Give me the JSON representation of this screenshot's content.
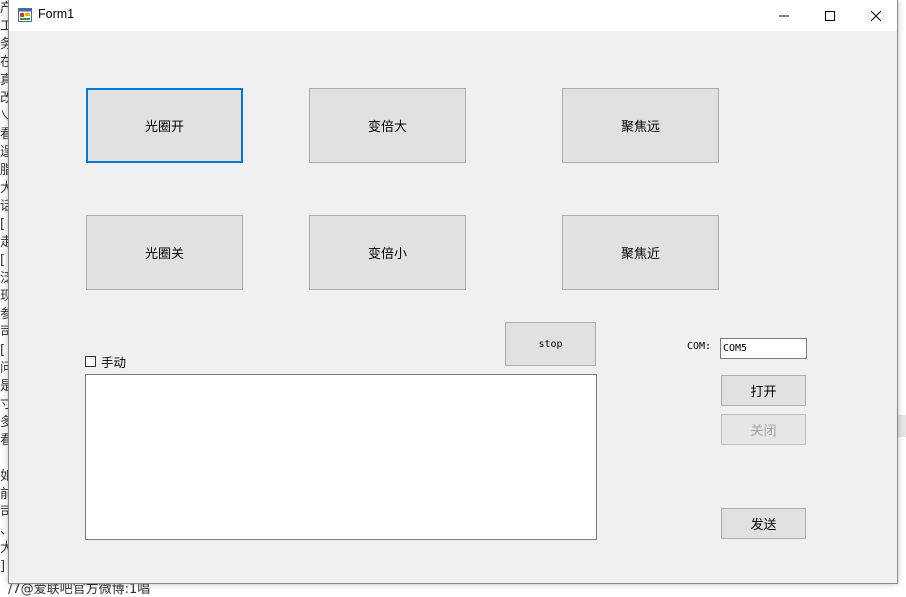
{
  "window": {
    "title": "Form1",
    "controls": {
      "minimize": "minimize",
      "maximize": "maximize",
      "close": "close"
    }
  },
  "buttons": {
    "iris_open": "光圈开",
    "zoom_in": "变倍大",
    "focus_far": "聚焦远",
    "iris_close": "光圈关",
    "zoom_out": "变倍小",
    "focus_near": "聚焦近",
    "stop": "stop",
    "open": "打开",
    "close": "关闭",
    "send": "发送"
  },
  "manual": {
    "label": "手动",
    "checked": false
  },
  "log": {
    "value": ""
  },
  "com": {
    "label": "COM:",
    "value": "COM5"
  },
  "background": {
    "left_strip_chars": [
      "产",
      "工",
      "务",
      "在",
      "真",
      "改",
      "乀",
      "看",
      "逞",
      "脂",
      "大",
      "话",
      "[",
      "走",
      "[",
      "泛",
      "现",
      "参",
      "司",
      "[",
      "问",
      "是",
      "寸",
      "多",
      "看",
      "",
      "如",
      "前",
      "司",
      "、",
      "大",
      "]"
    ],
    "bottom_text": "/7@爱联吧官方微博:1唱"
  },
  "colors": {
    "accent": "#0078d7",
    "button_bg": "#e1e1e1",
    "window_bg": "#f0f0f0"
  }
}
